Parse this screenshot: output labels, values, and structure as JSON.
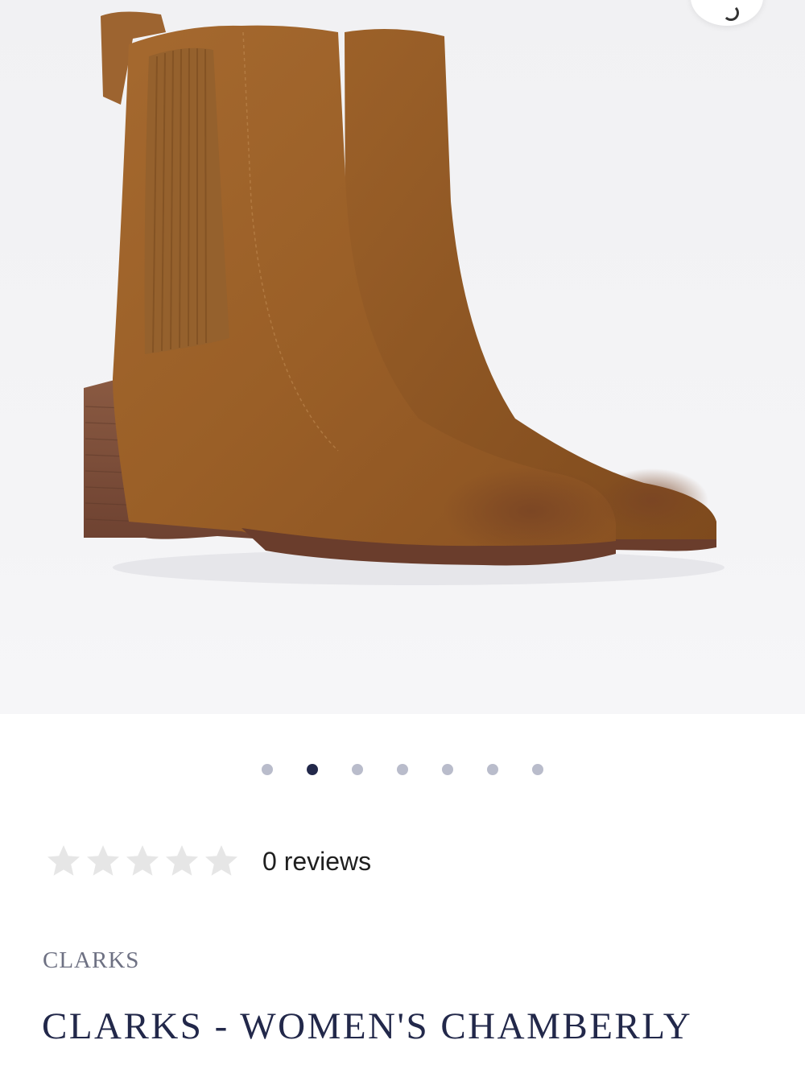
{
  "product_image": {
    "alt": "Brown suede Chelsea ankle boots with stacked block heel"
  },
  "zoom_button": {
    "icon": "zoom-icon"
  },
  "carousel": {
    "dot_count": 7,
    "active_index": 1
  },
  "rating": {
    "stars_filled": 0,
    "stars_total": 5,
    "reviews_label": "0 reviews"
  },
  "product": {
    "brand": "CLARKS",
    "title": "CLARKS - WOMEN'S CHAMBERLY"
  },
  "colors": {
    "title": "#22284a",
    "brand": "#6e7183",
    "active_dot": "#22284a",
    "inactive_dot": "#b9bccb",
    "star_empty": "#e6e6e6"
  }
}
